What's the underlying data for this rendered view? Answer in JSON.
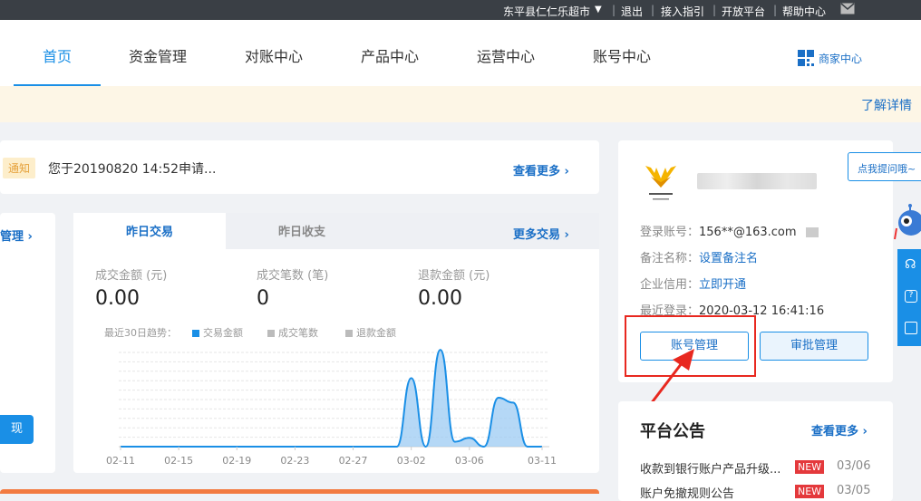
{
  "topbar": {
    "store_name": "东平县仁仁乐超市",
    "logout": "退出",
    "access_guide": "接入指引",
    "open_platform": "开放平台",
    "help_center": "帮助中心",
    "divider": "|"
  },
  "nav": {
    "items": [
      "首页",
      "资金管理",
      "对账中心",
      "产品中心",
      "运营中心",
      "账号中心"
    ],
    "merchant_center": "商家中心"
  },
  "banner": {
    "learn_more": "了解详情"
  },
  "notice": {
    "tag": "通知",
    "text": "您于20190820 14:52申请...",
    "more": "查看更多 ›"
  },
  "left_panel": {
    "link": "管理 ›",
    "button": "现"
  },
  "transactions": {
    "tabs": [
      "昨日交易",
      "昨日收支"
    ],
    "more": "更多交易 ›",
    "stats": [
      {
        "label": "成交金额 (元)",
        "value": "0.00"
      },
      {
        "label": "成交笔数 (笔)",
        "value": "0"
      },
      {
        "label": "退款金额 (元)",
        "value": "0.00"
      }
    ],
    "trend_label": "最近30日趋势：",
    "legend": [
      "交易金额",
      "成交笔数",
      "退款金额"
    ]
  },
  "chart_data": {
    "type": "area",
    "x_ticks": [
      "02-11",
      "02-15",
      "02-19",
      "02-23",
      "02-27",
      "03-02",
      "03-06",
      "03-11"
    ],
    "series": [
      {
        "name": "交易金额",
        "color": "#1a8fe6",
        "points": [
          {
            "x": "02-11",
            "y": 0
          },
          {
            "x": "03-01",
            "y": 0
          },
          {
            "x": "03-02",
            "y": 0.7
          },
          {
            "x": "03-03",
            "y": 0
          },
          {
            "x": "03-04",
            "y": 0.99
          },
          {
            "x": "03-05",
            "y": 0.05
          },
          {
            "x": "03-06",
            "y": 0.09
          },
          {
            "x": "03-07",
            "y": 0
          },
          {
            "x": "03-08",
            "y": 0.5
          },
          {
            "x": "03-09",
            "y": 0.45
          },
          {
            "x": "03-10",
            "y": 0
          },
          {
            "x": "03-11",
            "y": 0
          }
        ]
      }
    ],
    "grid": true
  },
  "account": {
    "login_label": "登录账号：",
    "login_value": "156**@163.com",
    "remark_label": "备注名称：",
    "remark_link": "设置备注名",
    "credit_label": "企业信用：",
    "credit_link": "立即开通",
    "last_login_label": "最近登录：",
    "last_login_value": "2020-03-12 16:41:16",
    "btn_account": "账号管理",
    "btn_approval": "审批管理"
  },
  "announcements": {
    "title": "平台公告",
    "more": "查看更多 ›",
    "items": [
      {
        "text": "收款到银行账户产品升级...",
        "badge": "NEW",
        "date": "03/06"
      },
      {
        "text": "账户免撤规则公告",
        "badge": "NEW",
        "date": "03/05"
      }
    ]
  },
  "helper": {
    "ask": "点我提问哦~"
  },
  "colors": {
    "accent": "#1a8fe6",
    "highlight": "#e8281f",
    "badge": "#e4393c"
  }
}
